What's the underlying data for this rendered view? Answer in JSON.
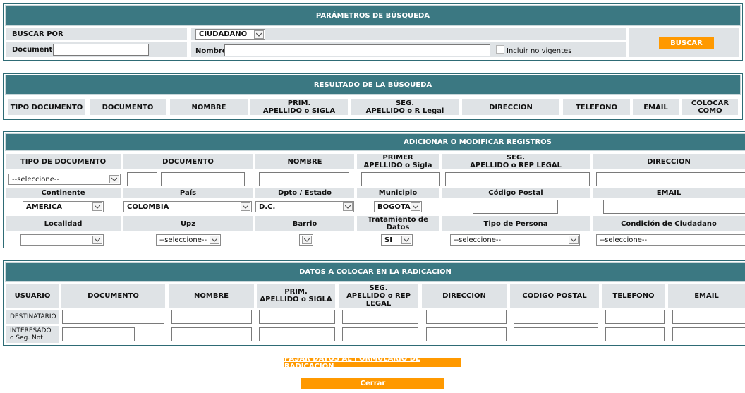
{
  "search": {
    "title": "PARÁMETROS DE BÚSQUEDA",
    "buscar_por_label": "BUSCAR POR",
    "buscar_por_value": "CIUDADANO",
    "documento_label": "Documento",
    "nombre_label": "Nombre",
    "incluir_label": "Incluir no vigentes",
    "buscar_button": "BUSCAR"
  },
  "results": {
    "title": "RESULTADO DE LA BÚSQUEDA",
    "columns": [
      "TIPO DOCUMENTO",
      "DOCUMENTO",
      "NOMBRE",
      "PRIM.\nAPELLIDO o SIGLA",
      "SEG.\nAPELLIDO o R Legal",
      "DIRECCION",
      "TELEFONO",
      "EMAIL",
      "COLOCAR\nCOMO"
    ]
  },
  "register": {
    "title": "ADICIONAR O MODIFICAR REGISTROS",
    "row1_headers": [
      "TIPO DE DOCUMENTO",
      "DOCUMENTO",
      "NOMBRE",
      "PRIMER\nAPELLIDO o Sigla",
      "SEG.\nAPELLIDO o REP LEGAL",
      "DIRECCION"
    ],
    "tipo_doc_value": "--seleccione--",
    "row2_headers": [
      "Continente",
      "País",
      "Dpto / Estado",
      "Municipio",
      "Código Postal",
      "EMAIL"
    ],
    "continente_value": "AMERICA",
    "pais_value": "COLOMBIA",
    "dpto_value": "D.C.",
    "municipio_value": "BOGOTA",
    "row3_headers": [
      "Localidad",
      "Upz",
      "Barrio",
      "Tratamiento de\nDatos",
      "Tipo de Persona",
      "Condición de Ciudadano"
    ],
    "localidad_value": "",
    "upz_value": "--seleccione--",
    "barrio_value": "",
    "tratamiento_value": "SI",
    "tipo_persona_value": "--seleccione--",
    "condicion_value": "--seleccione--"
  },
  "radicacion": {
    "title": "DATOS A COLOCAR EN LA RADICACION",
    "columns": [
      "USUARIO",
      "DOCUMENTO",
      "NOMBRE",
      "PRIM.\nAPELLIDO o SIGLA",
      "SEG.\nAPELLIDO o REP\nLEGAL",
      "DIRECCION",
      "CODIGO POSTAL",
      "TELEFONO",
      "EMAIL"
    ],
    "row_destinatario": "DESTINATARIO",
    "row_interesado": "INTERESADO\no Seg. Not"
  },
  "footer": {
    "pasar_link": "PASAR DATOS AL FORMULARIO DE RADICACION",
    "cerrar_button": "Cerrar"
  }
}
